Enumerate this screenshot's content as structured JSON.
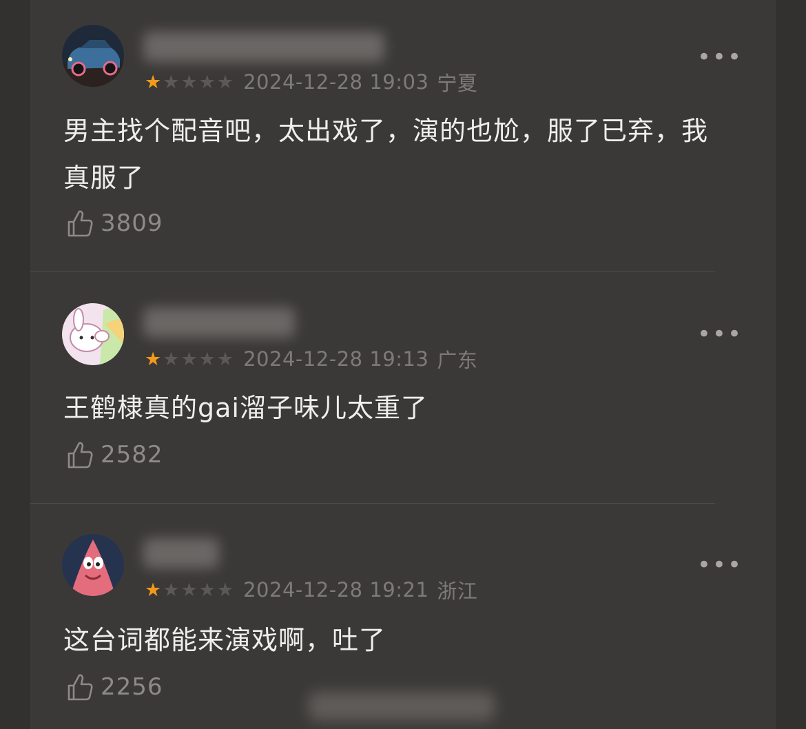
{
  "comments": [
    {
      "avatar_name": "car-avatar",
      "rating": 1,
      "max_rating": 5,
      "datetime": "2024-12-28 19:03",
      "region": "宁夏",
      "text": "男主找个配音吧，太出戏了，演的也尬，服了已弃，我真服了",
      "likes": "3809",
      "more": "•••"
    },
    {
      "avatar_name": "cartoon-rabbit-avatar",
      "rating": 1,
      "max_rating": 5,
      "datetime": "2024-12-28 19:13",
      "region": "广东",
      "text": "王鹤棣真的gai溜子味儿太重了",
      "likes": "2582",
      "more": "•••"
    },
    {
      "avatar_name": "patrick-star-avatar",
      "rating": 1,
      "max_rating": 5,
      "datetime": "2024-12-28 19:21",
      "region": "浙江",
      "text": "这台词都能来演戏啊，吐了",
      "likes": "2256",
      "more": "•••"
    }
  ],
  "colors": {
    "background": "#3b3937",
    "star_active": "#f29a1c",
    "star_inactive": "#5b5856",
    "text_primary": "#eeeeec",
    "text_secondary": "#7d7a78"
  }
}
